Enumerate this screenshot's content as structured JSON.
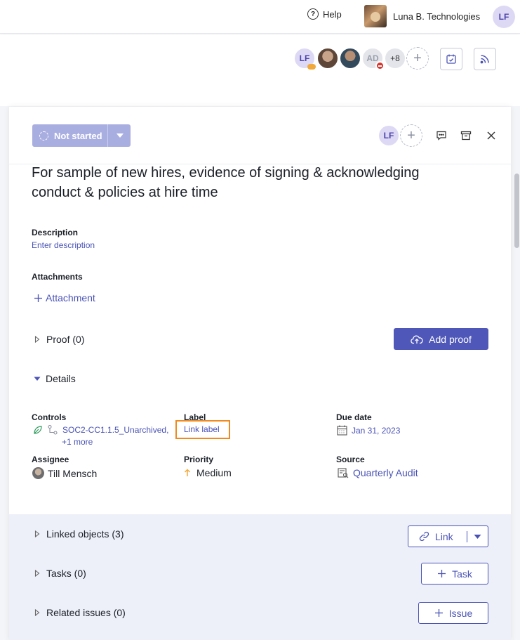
{
  "topbar": {
    "help_label": "Help",
    "org_name": "Luna B. Technologies",
    "user_initials": "LF"
  },
  "collaborators": {
    "first_initials": "LF",
    "ad_initials": "AD",
    "more_count": "+8",
    "add_symbol": "+"
  },
  "panel": {
    "status_label": "Not started",
    "assignee_initials": "LF",
    "title": "For sample of new hires, evidence of signing & acknowledging conduct & policies at hire time",
    "description_label": "Description",
    "description_placeholder": "Enter description",
    "attachments_label": "Attachments",
    "attachment_link": "Attachment",
    "proof_label": "Proof (0)",
    "add_proof_label": "Add proof",
    "details_label": "Details"
  },
  "details": {
    "controls_label": "Controls",
    "controls_value": "SOC2-CC1.1.5_Unarchived,",
    "controls_more": "+1 more",
    "label_label": "Label",
    "label_link": "Link label",
    "due_label": "Due date",
    "due_value": "Jan 31, 2023",
    "assignee_label": "Assignee",
    "assignee_value": "Till Mensch",
    "priority_label": "Priority",
    "priority_value": "Medium",
    "source_label": "Source",
    "source_value": "Quarterly Audit"
  },
  "related": {
    "linked_label": "Linked objects (3)",
    "link_button": "Link",
    "tasks_label": "Tasks (0)",
    "task_button": "Task",
    "issues_label": "Related issues (0)",
    "issue_button": "Issue"
  },
  "colors": {
    "accent": "#4f57b8",
    "status_bg": "#a9aee0",
    "highlight": "#f08a1c",
    "priority_arrow": "#f2a93b"
  }
}
